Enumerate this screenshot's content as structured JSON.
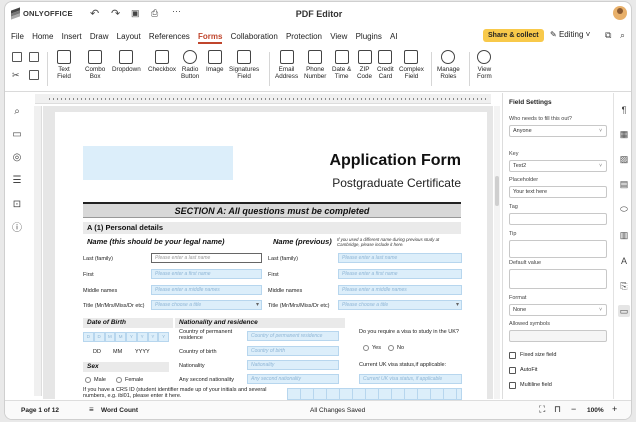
{
  "app": {
    "logo_text": "ONLYOFFICE",
    "title": "PDF Editor"
  },
  "menu": [
    "File",
    "Home",
    "Insert",
    "Draw",
    "Layout",
    "References",
    "Forms",
    "Collaboration",
    "Protection",
    "View",
    "Plugins",
    "AI"
  ],
  "menu_active": "Forms",
  "share_label": "Share & collect",
  "editing_label": "Editing",
  "toolbar": {
    "text_field": "Text\nField",
    "combo_box": "Combo\nBox",
    "dropdown": "Dropdown",
    "checkbox": "Checkbox",
    "radio_button": "Radio\nButton",
    "image": "Image",
    "signatures_field": "Signatures\nField",
    "email_address": "Email\nAddress",
    "phone_number": "Phone\nNumber",
    "date_time": "Date &\nTime",
    "zip_code": "ZIP\nCode",
    "credit_card": "Credit\nCard",
    "complex_field": "Complex\nField",
    "manage_roles": "Manage\nRoles",
    "view_form": "View\nForm"
  },
  "doc": {
    "title": "Application Form",
    "subtitle": "Postgraduate Certificate",
    "section_a": "SECTION A: All questions must be completed",
    "personal": "A (1) Personal details",
    "name_legal": "Name (this should be your legal name)",
    "name_previous": "Name (previous)",
    "name_prev_note": "If you used a different name during previous study at Cambridge, please include it here.",
    "labels": {
      "last_family": "Last (family)",
      "first": "First",
      "middle": "Middle names",
      "title": "Title (Mr/Mrs/Miss/Dr etc)"
    },
    "placeholders": {
      "last": "Please enter a last name",
      "first": "Please enter a first name",
      "middle": "Please enter a middle names",
      "title": "Please choose a title"
    },
    "dob": "Date of Birth",
    "dob_boxes": [
      "D",
      "D",
      "M",
      "M",
      "Y",
      "Y",
      "Y",
      "Y"
    ],
    "dob_labels": [
      "DD",
      "MM",
      "YYYY"
    ],
    "nationality": "Nationality and residence",
    "country_perm": "Country of permanent residence",
    "country_perm_ph": "Country of permanent residence",
    "country_birth": "Country of birth",
    "country_birth_ph": "Country of birth",
    "nationality_lbl": "Nationality",
    "nationality_ph": "Nationality",
    "any_second": "Any second nationality",
    "any_second_ph": "Any second nationality",
    "visa_q": "Do you require a visa to study in the UK?",
    "yes": "Yes",
    "no": "No",
    "visa_status": "Current UK visa status,if applicable:",
    "visa_status_ph": "Current UK visa status, if applicable",
    "sex": "Sex",
    "male": "Male",
    "female": "Female",
    "crs": "If you have a CRS ID (student identifier made up of your initials and several numbers, e.g. ibl01, please enter it here."
  },
  "panel": {
    "title": "Field Settings",
    "who_label": "Who needs to fill this out?",
    "who_value": "Anyone",
    "key_label": "Key",
    "key_value": "Text2",
    "placeholder_label": "Placeholder",
    "placeholder_value": "Your text here",
    "tag_label": "Tag",
    "tip_label": "Tip",
    "default_label": "Default value",
    "format_label": "Format",
    "format_value": "None",
    "allowed_label": "Allowed symbols",
    "fixed_size": "Fixed size field",
    "autofit": "AutoFit",
    "multiline": "Multiline field"
  },
  "status": {
    "page": "Page 1 of 12",
    "word_count": "Word Count",
    "saved": "All Changes Saved",
    "zoom": "100%"
  }
}
